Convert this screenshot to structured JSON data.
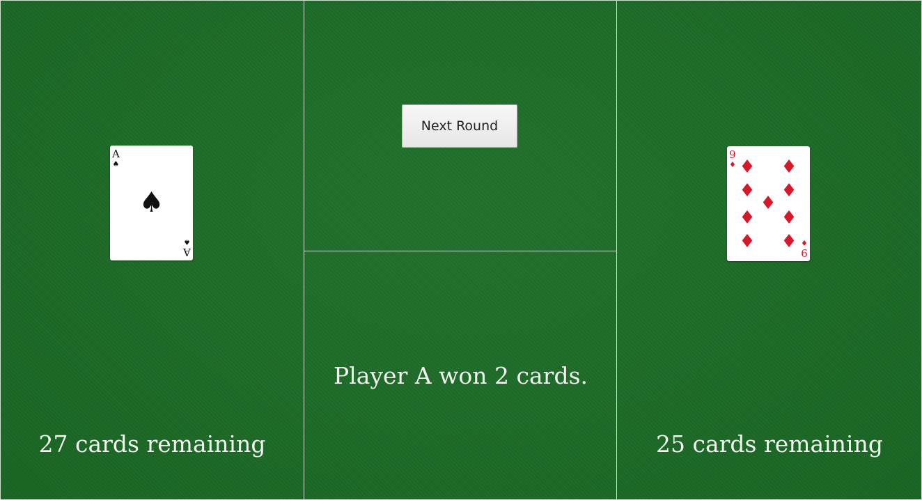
{
  "left_player": {
    "card": {
      "rank": "A",
      "suit": "♠",
      "suit_name": "spades",
      "color": "#111111"
    },
    "remaining_text": "27 cards remaining"
  },
  "right_player": {
    "card": {
      "rank": "9",
      "suit": "♦",
      "suit_name": "diamonds",
      "color": "#d7182a"
    },
    "remaining_text": "25 cards remaining"
  },
  "controls": {
    "next_round_label": "Next Round"
  },
  "result": {
    "message": "Player A won 2 cards."
  },
  "colors": {
    "felt": "#1b6c26",
    "divider": "#cfe3cf",
    "text": "#f2f5ef"
  }
}
